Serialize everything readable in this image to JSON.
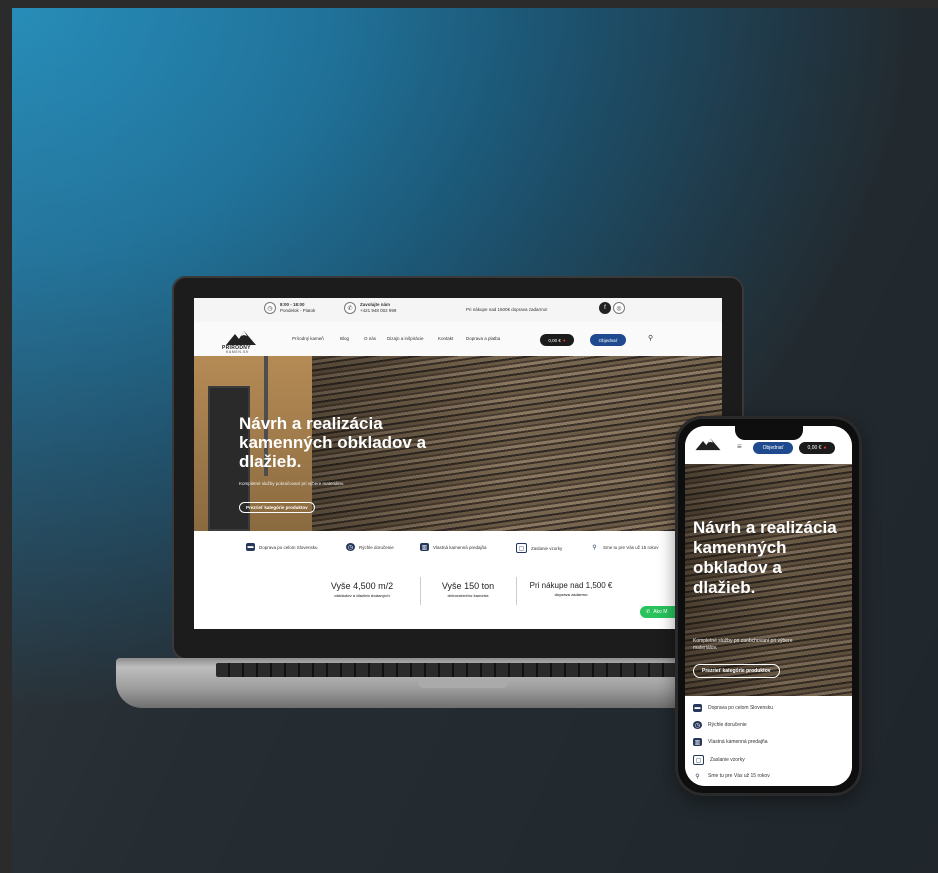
{
  "laptop": {
    "topbar": {
      "hours_title": "8:00 - 18:00",
      "hours_sub": "Pondelok - Piatok",
      "contact_title": "Zavolajte nám",
      "contact_sub": "+421 948 002 999",
      "shipping_note": "Pri nákupe nad 1500€ doprava zadarmo!",
      "social_icons": [
        "facebook-icon",
        "instagram-icon"
      ]
    },
    "logo": {
      "name": "PRÍRODNÝ",
      "sub": "KAMEN.SK"
    },
    "nav": {
      "items": [
        "Prírodný kameň",
        "Blog",
        "O nás",
        "Dizajn a inšpirácie",
        "Kontakt",
        "Doprava a platba"
      ],
      "cart_label": "0,00 €",
      "order_label": "Objednať",
      "search_icon": "search-icon"
    },
    "hero": {
      "title": "Návrh a realizácia kamenných obkladov a dlažieb.",
      "subtitle": "Kompletné služby pokračovaní pri výbere materiálov.",
      "button_label": "Prezrieť kategórie produktov"
    },
    "features": [
      {
        "icon": "truck-icon",
        "label": "Doprava po celom Slovensku"
      },
      {
        "icon": "clock-icon",
        "label": "Rýchle doručenie"
      },
      {
        "icon": "store-icon",
        "label": "Vlastná kamenná predajňa"
      },
      {
        "icon": "box-icon",
        "label": "Zaslanie vzorky"
      },
      {
        "icon": "pin-icon",
        "label": "Sme tu pre Vás už 15 rokov"
      }
    ],
    "stats": [
      {
        "value": "Vyše 4,500 m/2",
        "label": "obkladov a dlažieb dodaných"
      },
      {
        "value": "Vyše 150 ton",
        "label": "dekoračného kameňa"
      },
      {
        "value": "Pri nákupe nad 1,500 €",
        "label": "doprava zadarmo"
      }
    ],
    "whatsapp_label": "Ako M"
  },
  "phone": {
    "order_label": "Objednať",
    "cart_label": "0,00 €",
    "hero": {
      "title": "Návrh a realizácia kamenných obkladov a dlažieb.",
      "subtitle": "Kompletné služby pri zaobchovaní pri výbere materiálov.",
      "button_label": "Prezrieť kategórie produktov"
    },
    "features": [
      {
        "icon": "truck-icon",
        "label": "Doprava po celom Slovensku"
      },
      {
        "icon": "clock-icon",
        "label": "Rýchle doručenie"
      },
      {
        "icon": "store-icon",
        "label": "Vlastná kamenná predajňa"
      },
      {
        "icon": "box-icon",
        "label": "Zaslanie vzorky"
      },
      {
        "icon": "pin-icon",
        "label": "Sme tu pre Vás už 15 rokov"
      }
    ]
  },
  "colors": {
    "accent": "#1f4a8f",
    "dark_pill": "#1b1b1b",
    "whatsapp": "#28c35d",
    "icon_bg": "#25385a"
  }
}
